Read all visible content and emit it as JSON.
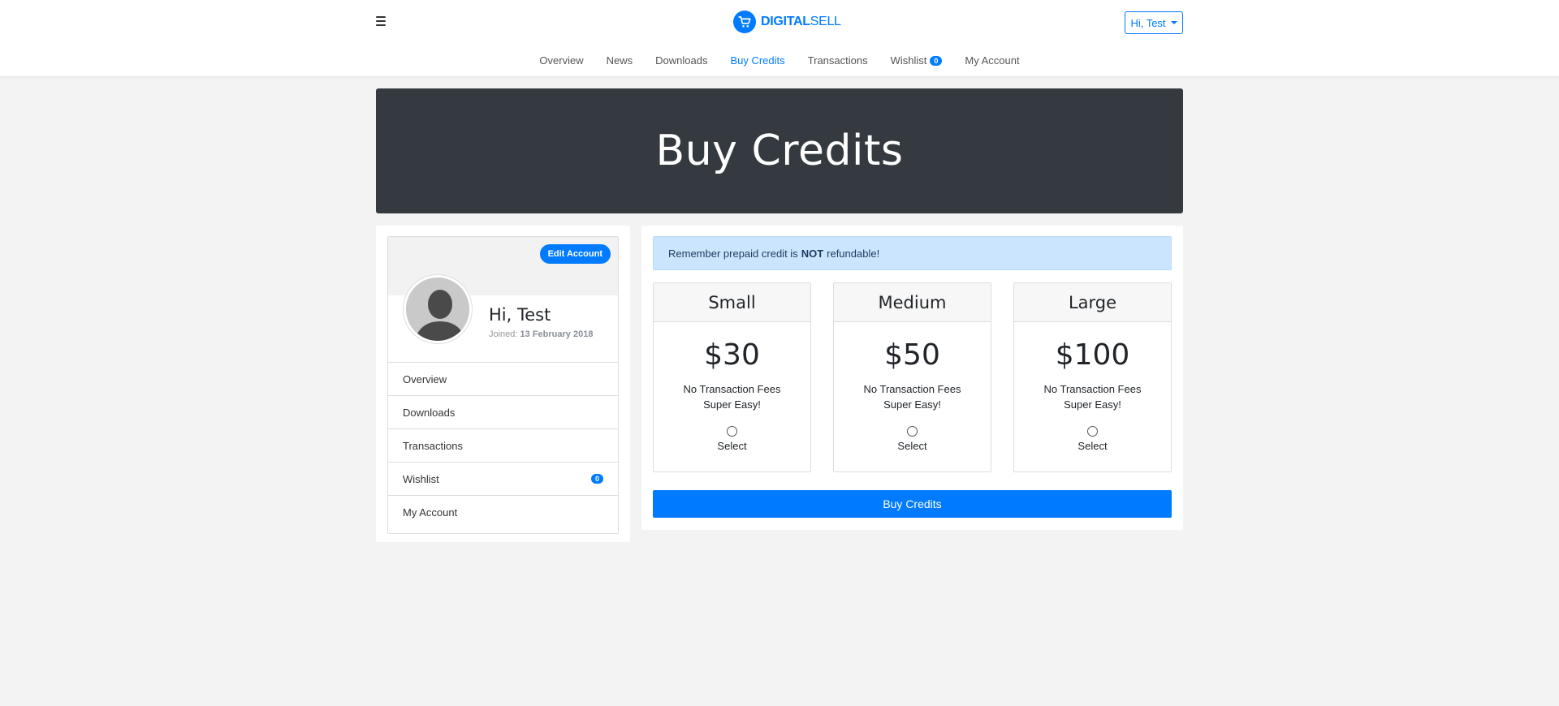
{
  "header": {
    "brand_bold": "DIGITAL",
    "brand_light": "SELL",
    "user_menu_label": "Hi, Test"
  },
  "nav": {
    "items": [
      {
        "label": "Overview"
      },
      {
        "label": "News"
      },
      {
        "label": "Downloads"
      },
      {
        "label": "Buy Credits",
        "active": true
      },
      {
        "label": "Transactions"
      },
      {
        "label": "Wishlist",
        "badge": "0"
      },
      {
        "label": "My Account"
      }
    ]
  },
  "hero": {
    "title": "Buy Credits"
  },
  "profile": {
    "edit_label": "Edit Account",
    "name": "Hi, Test",
    "joined_prefix": "Joined:",
    "joined_date": "13 February 2018",
    "menu": [
      {
        "label": "Overview"
      },
      {
        "label": "Downloads"
      },
      {
        "label": "Transactions"
      },
      {
        "label": "Wishlist",
        "badge": "0"
      },
      {
        "label": "My Account"
      }
    ]
  },
  "alert": {
    "pre": "Remember prepaid credit is",
    "strong": "NOT",
    "post": "refundable!"
  },
  "plans": [
    {
      "name": "Small",
      "price": "$30",
      "feature1": "No Transaction Fees",
      "feature2": "Super Easy!",
      "select_label": "Select"
    },
    {
      "name": "Medium",
      "price": "$50",
      "feature1": "No Transaction Fees",
      "feature2": "Super Easy!",
      "select_label": "Select"
    },
    {
      "name": "Large",
      "price": "$100",
      "feature1": "No Transaction Fees",
      "feature2": "Super Easy!",
      "select_label": "Select"
    }
  ],
  "buy_button_label": "Buy Credits",
  "colors": {
    "accent": "#007bff",
    "hero_bg": "#343a40",
    "alert_bg": "#cce5ff",
    "page_bg": "#f3f3f3"
  }
}
